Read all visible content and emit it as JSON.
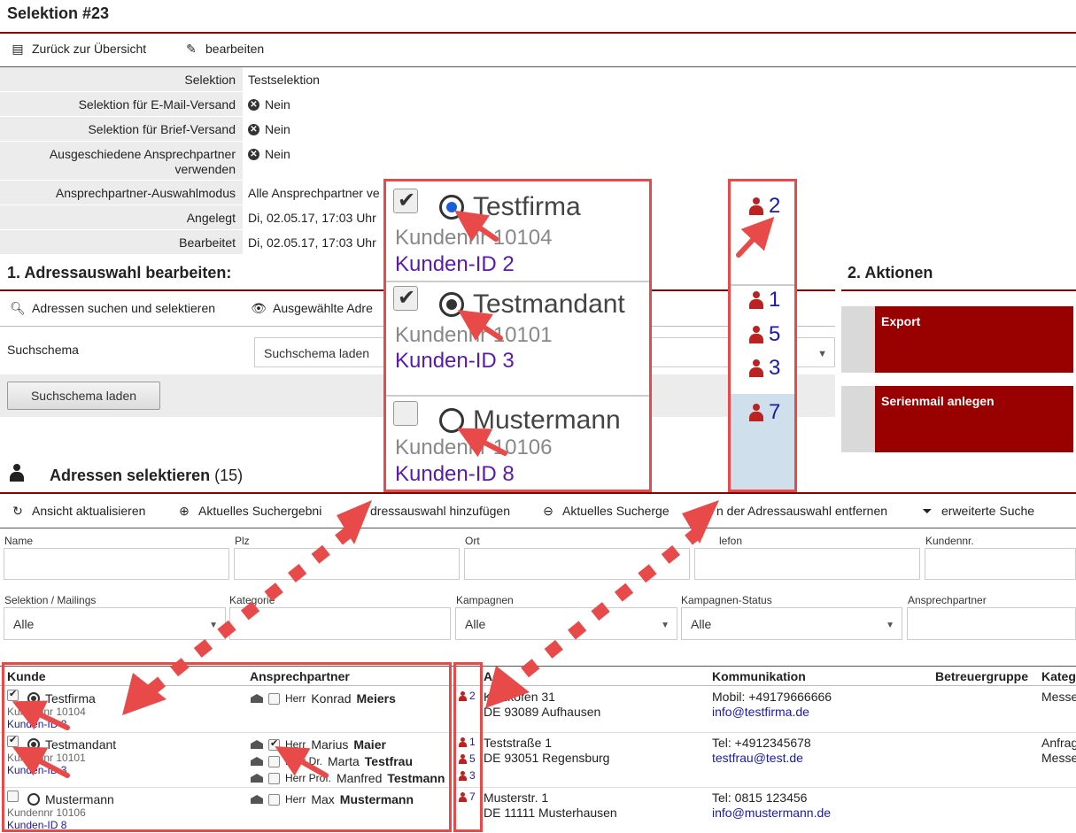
{
  "page": {
    "title": "Selektion #23"
  },
  "toolbar": {
    "back_label": "Zurück zur Übersicht",
    "edit_label": "bearbeiten"
  },
  "info": [
    {
      "label": "Selektion",
      "value": "Testselektion",
      "icon": ""
    },
    {
      "label": "Selektion für E-Mail-Versand",
      "value": "Nein",
      "icon": "x-circle-icon"
    },
    {
      "label": "Selektion für Brief-Versand",
      "value": "Nein",
      "icon": "x-circle-icon"
    },
    {
      "label": "Ausgeschiedene Ansprechpartner verwenden",
      "value": "Nein",
      "icon": "x-circle-icon"
    },
    {
      "label": "Ansprechpartner-Auswahlmodus",
      "value": "Alle Ansprechpartner ve",
      "icon": ""
    },
    {
      "label": "Angelegt",
      "value": "Di, 02.05.17, 17:03 Uhr",
      "icon": ""
    },
    {
      "label": "Bearbeitet",
      "value": "Di, 02.05.17, 17:03 Uhr",
      "icon": ""
    }
  ],
  "adressauswahl": {
    "title": "1. Adressauswahl bearbeiten:",
    "search_select_label": "Adressen suchen und selektieren",
    "selected_label": "Ausgewählte Adre",
    "schema_label": "Suchschema",
    "schema_select_value": "Suchschema laden",
    "schema_button": "Suchschema laden"
  },
  "aktionen": {
    "title": "2. Aktionen",
    "items": [
      "Export",
      "Serienmail anlegen"
    ]
  },
  "adressen": {
    "title": "Adressen selektieren",
    "count": "(15)",
    "toolbar": {
      "refresh": "Ansicht aktualisieren",
      "add": "Aktuelles Suchergebni",
      "add_rest": "dressauswahl hinzufügen",
      "remove": "Aktuelles Sucherge",
      "remove_rest": "n der Adressauswahl entfernen",
      "extended": "erweiterte Suche"
    },
    "filters_row1": [
      "Name",
      "Plz",
      "Ort",
      "lefon",
      "Kundennr."
    ],
    "filters_row2": {
      "selektion_label": "Selektion / Mailings",
      "selektion_value": "Alle",
      "kategorie_label": "Kategorie",
      "kampagnen_label": "Kampagnen",
      "kampagnen_value": "Alle",
      "kampagnen_status_label": "Kampagnen-Status",
      "kampagnen_status_value": "Alle",
      "ansprechpartner_label": "Ansprechpartner"
    },
    "columns": {
      "kunde": "Kunde",
      "ansprechpartner": "Ansprechpartner",
      "adresse": "Adr",
      "kommunikation": "Kommunikation",
      "betreuer": "Betreuergruppe",
      "kategorie": "Kateg"
    },
    "rows": [
      {
        "name": "Testfirma",
        "kundennr": "Kundennr 10104",
        "kunden_id": "Kunden-ID 2",
        "checked": true,
        "radio": true,
        "contacts": [
          {
            "salutation": "Herr",
            "first": "Konrad",
            "last": "Meiers",
            "checked": false
          }
        ],
        "counts": [
          "2"
        ],
        "address1": "Kelzkofen 31",
        "address2": "DE 93089 Aufhausen",
        "comm1": "Mobil: +49179666666",
        "comm2": "info@testfirma.de",
        "kategorie": "Messe"
      },
      {
        "name": "Testmandant",
        "kundennr": "Kundennr 10101",
        "kunden_id": "Kunden-ID 3",
        "checked": true,
        "radio": true,
        "contacts": [
          {
            "salutation": "Herr",
            "first": "Marius",
            "last": "Maier",
            "checked": true
          },
          {
            "salutation": "Herr Dr.",
            "first": "Marta",
            "last": "Testfrau",
            "checked": false
          },
          {
            "salutation": "Herr Prof.",
            "first": "Manfred",
            "last": "Testmann",
            "checked": false
          }
        ],
        "counts": [
          "1",
          "5",
          "3"
        ],
        "address1": "Teststraße 1",
        "address2": "DE 93051 Regensburg",
        "comm1": "Tel: +4912345678",
        "comm2": "testfrau@test.de",
        "kategorie": "Anfrag",
        "kategorie2": "Messe"
      },
      {
        "name": "Mustermann",
        "kundennr": "Kundennr 10106",
        "kunden_id": "Kunden-ID 8",
        "checked": false,
        "radio": false,
        "contacts": [
          {
            "salutation": "Herr",
            "first": "Max",
            "last": "Mustermann",
            "checked": false
          }
        ],
        "counts": [
          "7"
        ],
        "address1": "Musterstr. 1",
        "address2": "DE 11111 Musterhausen",
        "comm1": "Tel: 0815 123456",
        "comm2": "info@mustermann.de",
        "kategorie": ""
      }
    ]
  },
  "zoom": {
    "rows": [
      {
        "name": "Testfirma",
        "kundennr": "Kundennr 10104",
        "kunden_id": "Kunden-ID 2"
      },
      {
        "name": "Testmandant",
        "kundennr": "Kundennr 10101",
        "kunden_id": "Kunden-ID 3"
      },
      {
        "name": "Mustermann",
        "kundennr": "Kundennr 10106",
        "kunden_id": "Kunden-ID 8"
      }
    ],
    "counts": [
      "2",
      "1",
      "5",
      "3",
      "7"
    ]
  },
  "colors": {
    "accent": "#8b0000",
    "action": "#990000",
    "annotation": "#e84a4a",
    "link": "#1a1aa8"
  }
}
